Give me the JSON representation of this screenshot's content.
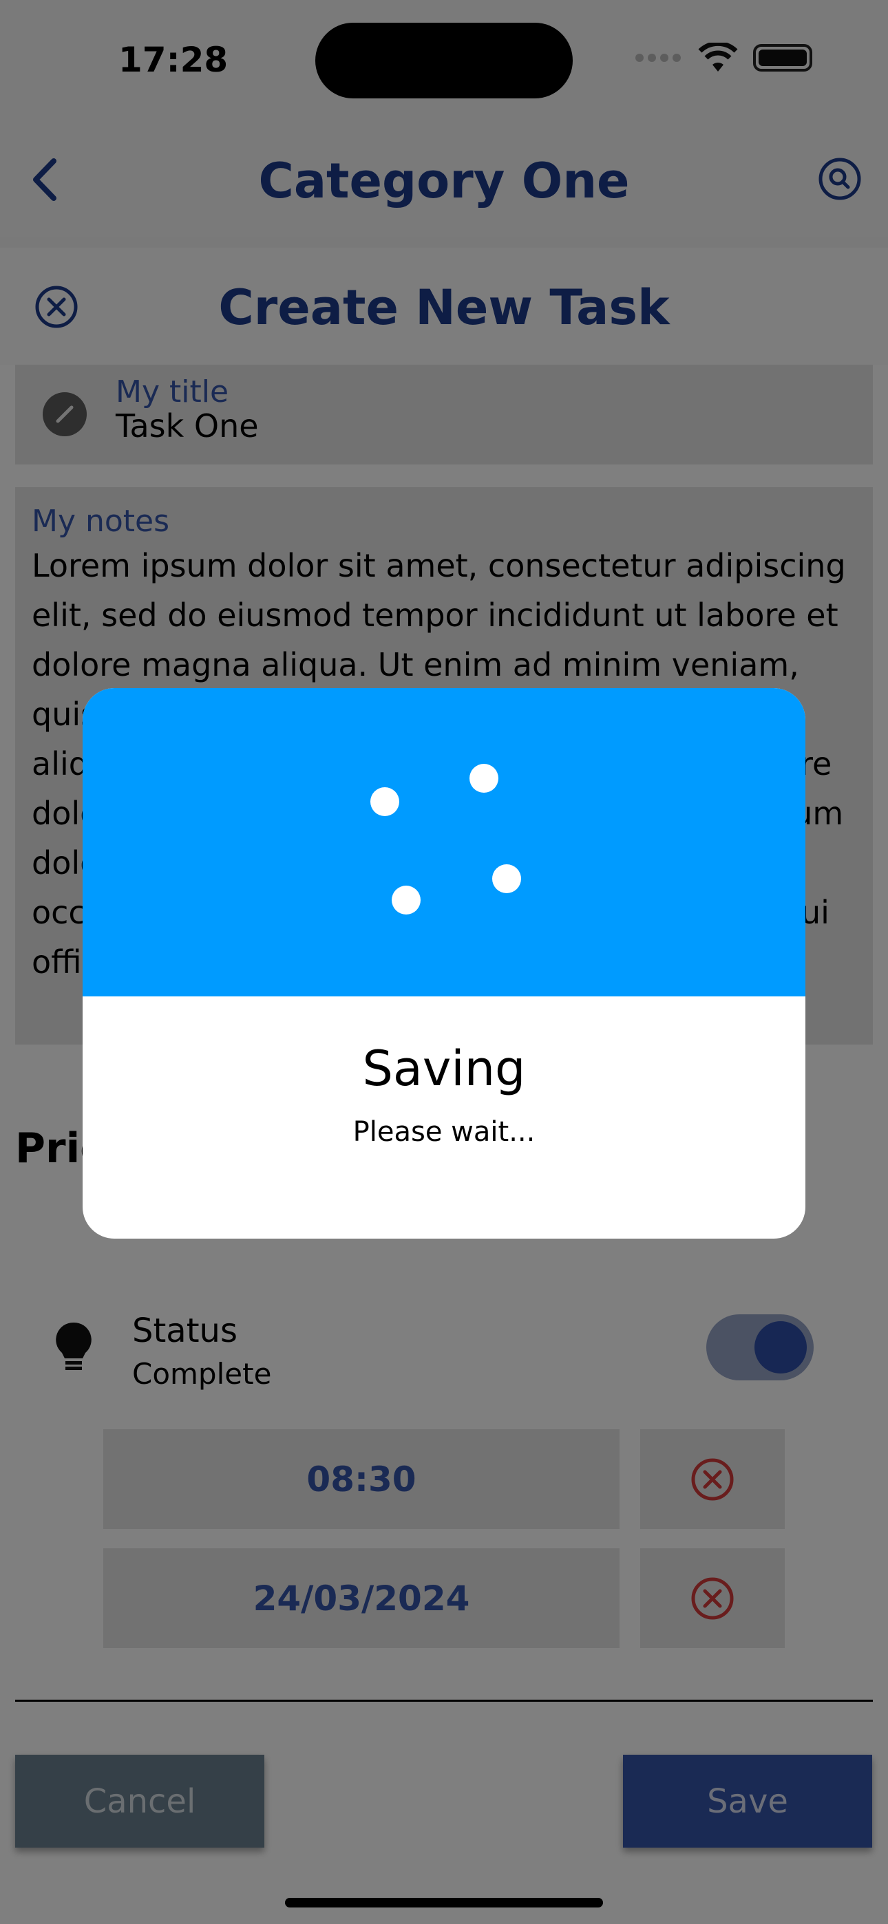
{
  "status_bar": {
    "time": "17:28"
  },
  "nav": {
    "title": "Category One"
  },
  "sheet": {
    "title": "Create New Task",
    "title_field": {
      "label": "My title",
      "value": "Task One"
    },
    "notes_field": {
      "label": "My notes",
      "value": "Lorem ipsum dolor sit amet, consectetur adipiscing elit, sed do eiusmod tempor incididunt ut labore et dolore magna aliqua. Ut enim ad minim veniam, quis nostrud exercitation ullamco laboris nisi ut aliquip ex ea commodo consequat. Duis aute irure dolor in reprehenderit in voluptate velit esse cillum dolore eu fugiat nulla pariatur. Excepteur sint occaecat cupidatat non proident, sunt in culpa qui officia deserunt mollit anim id est laborum."
    },
    "priority_label": "Priority",
    "status": {
      "title": "Status",
      "value": "Complete",
      "toggle_on": true
    },
    "time_value": "08:30",
    "date_value": "24/03/2024",
    "cancel_label": "Cancel",
    "save_label": "Save"
  },
  "dialog": {
    "title": "Saving",
    "subtitle": "Please wait..."
  },
  "colors": {
    "accent_blue": "#009bff",
    "brand_navy": "#1d3a8a",
    "remove_red": "#d23b3b"
  },
  "icons": [
    "back-chevron-icon",
    "search-icon",
    "close-circle-icon",
    "edit-icon",
    "lightbulb-icon",
    "remove-circle-icon"
  ]
}
